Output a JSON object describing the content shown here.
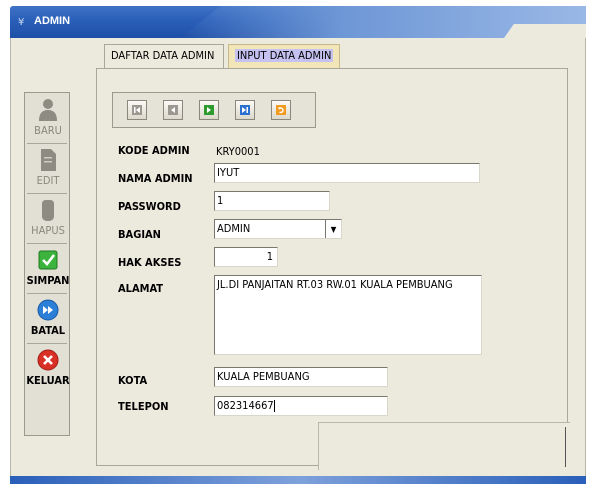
{
  "window": {
    "title": "ADMIN",
    "title_icon": "minimize-chevron-icon"
  },
  "tabs": [
    {
      "label": "DAFTAR DATA ADMIN",
      "active": false
    },
    {
      "label": "INPUT DATA ADMIN",
      "active": true
    }
  ],
  "sidebar": {
    "buttons": [
      {
        "label": "BARU",
        "icon": "person-icon",
        "enabled": false
      },
      {
        "label": "EDIT",
        "icon": "document-icon",
        "enabled": false
      },
      {
        "label": "HAPUS",
        "icon": "hand-icon",
        "enabled": false
      },
      {
        "label": "SIMPAN",
        "icon": "checkmark-icon",
        "enabled": true,
        "color": "#3cb33c"
      },
      {
        "label": "BATAL",
        "icon": "fast-forward-icon",
        "enabled": true,
        "color": "#2b7fd6"
      },
      {
        "label": "KELUAR",
        "icon": "close-icon",
        "enabled": true,
        "color": "#d93025"
      }
    ]
  },
  "navigator": {
    "buttons": [
      {
        "name": "first-record",
        "icon": "skip-first-icon"
      },
      {
        "name": "previous-record",
        "icon": "previous-icon"
      },
      {
        "name": "next-record",
        "icon": "next-icon",
        "color": "#2e9b2e"
      },
      {
        "name": "last-record",
        "icon": "skip-last-icon",
        "color": "#2b6fd0"
      },
      {
        "name": "refresh",
        "icon": "refresh-icon",
        "color": "#f29b22"
      }
    ]
  },
  "form": {
    "kode_admin": {
      "label": "KODE ADMIN",
      "value": "KRY0001"
    },
    "nama_admin": {
      "label": "NAMA ADMIN",
      "value": "IYUT"
    },
    "password": {
      "label": "PASSWORD",
      "value": "1"
    },
    "bagian": {
      "label": "BAGIAN",
      "value": "ADMIN"
    },
    "hak_akses": {
      "label": "HAK AKSES",
      "value": "1"
    },
    "alamat": {
      "label": "ALAMAT",
      "value": "JL.DI PANJAITAN RT.03 RW.01 KUALA PEMBUANG"
    },
    "kota": {
      "label": "KOTA",
      "value": "KUALA PEMBUANG"
    },
    "telepon": {
      "label": "TELEPON",
      "value": "082314667"
    }
  }
}
